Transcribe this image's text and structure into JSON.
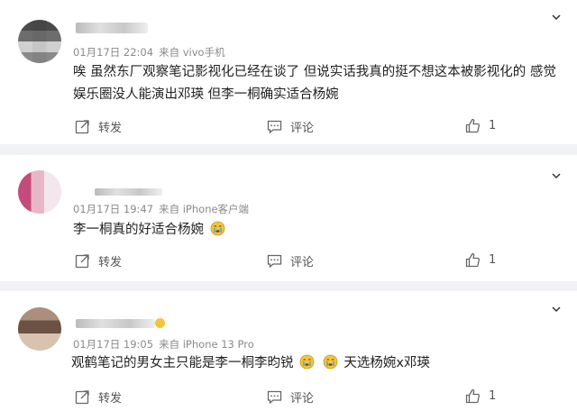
{
  "comments": [
    {
      "time": "01月17日 22:04",
      "source": "来自 vivo手机",
      "text": "唉 虽然东厂观察笔记影视化已经在谈了 但说实话我真的挺不想这本被影视化的 感觉娱乐圈没人能演出邓瑛 但李一桐确实适合杨婉",
      "repost_label": "转发",
      "comment_label": "评论",
      "like_count": "1"
    },
    {
      "time": "01月17日 19:47",
      "source": "来自 iPhone客户端",
      "text": "李一桐真的好适合杨婉",
      "repost_label": "转发",
      "comment_label": "评论",
      "like_count": "1"
    },
    {
      "time": "01月17日 19:05",
      "source": "来自 iPhone 13 Pro",
      "text_part1": "观鹤笔记的男女主只能是李一桐李昀锐",
      "text_part2": "天选杨婉x邓瑛",
      "repost_label": "转发",
      "comment_label": "评论",
      "like_count": "1"
    }
  ],
  "icons": {
    "more": "chevron-down-icon",
    "repost": "share-icon",
    "comment": "comment-icon",
    "like": "thumbs-up-icon",
    "emoji": "crying-face-icon"
  },
  "colors": {
    "page_bg": "#f1f2f5",
    "card_bg": "#ffffff",
    "meta_text": "#8a8a8a",
    "emoji_yellow": "#f3c53a"
  }
}
